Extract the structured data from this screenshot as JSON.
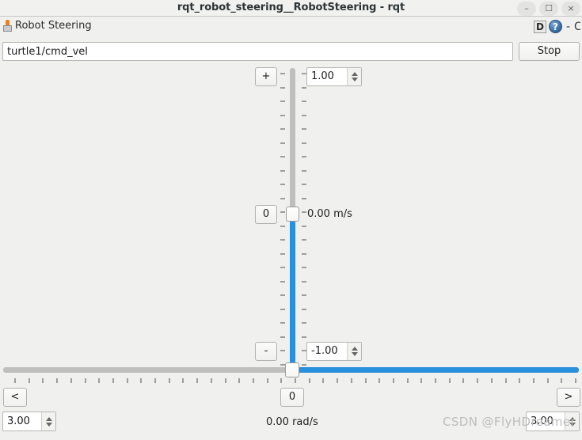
{
  "window": {
    "title": "rqt_robot_steering__RobotSteering - rqt",
    "buttons": {
      "minimize": "–",
      "maximize": "☐",
      "close": "×"
    }
  },
  "plugin": {
    "icon": "pin-icon",
    "title": "Robot Steering",
    "actions": {
      "dock": "D",
      "help": "?",
      "minimize": "-",
      "close": "C"
    }
  },
  "topic": {
    "value": "turtle1/cmd_vel",
    "placeholder": "turtle1/cmd_vel",
    "stop_label": "Stop"
  },
  "linear": {
    "increase_label": "+",
    "zero_label": "0",
    "decrease_label": "-",
    "max_value": "1.00",
    "min_value": "-1.00",
    "current_value": "0.00 m/s"
  },
  "angular": {
    "left_label": "<",
    "zero_label": "0",
    "right_label": ">",
    "max_value": "3.00",
    "min_value": "3.00",
    "current_value": "0.00 rad/s"
  },
  "watermark": {
    "text": "CSDN @FlyHDreamer"
  },
  "colors": {
    "accent": "#2a8fdd",
    "track": "#bfbfbd",
    "background": "#f0f0ef",
    "text": "#1f1f1f"
  }
}
